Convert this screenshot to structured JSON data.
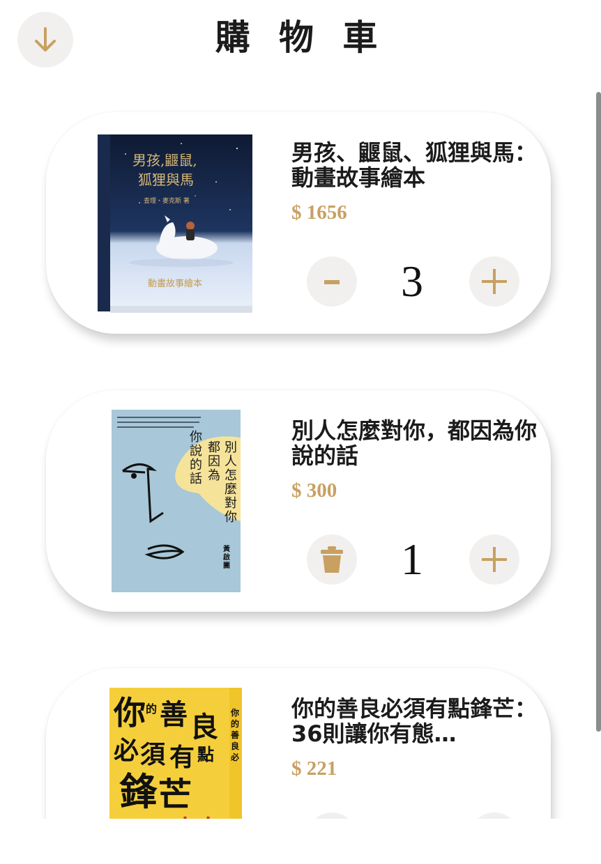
{
  "header": {
    "title": "購 物 車",
    "back_icon": "arrow-down-icon"
  },
  "theme": {
    "accent": "#c8a062",
    "button_bg": "#f1f0ef",
    "text": "#1b1b1b"
  },
  "cart": {
    "items": [
      {
        "title": "男孩、鼴鼠、狐狸與馬：動畫故事繪本",
        "price": "$ 1656",
        "quantity": "3",
        "decrement_label": "-",
        "increment_icon": "plus-icon",
        "cover": {
          "title_text": "男孩,鼴鼠,狐狸與馬",
          "author_text": "查理・麥克斯 著",
          "subtitle_text": "動畫故事繪本"
        }
      },
      {
        "title": "別人怎麼對你，都因為你說的話",
        "price": "$ 300",
        "quantity": "1",
        "delete_icon": "trash-icon",
        "increment_icon": "plus-icon",
        "cover": {
          "title_line1": "別人怎麼對你，",
          "title_line2": "都因為",
          "title_line3": "你說的話",
          "author_text": "黃啟團"
        }
      },
      {
        "title": "你的善良必須有點鋒芒：36則讓你有態…",
        "price": "$ 221",
        "cover": {
          "line1": "你的善良",
          "line2": "必須有點",
          "line3": "鋒芒"
        }
      }
    ]
  }
}
